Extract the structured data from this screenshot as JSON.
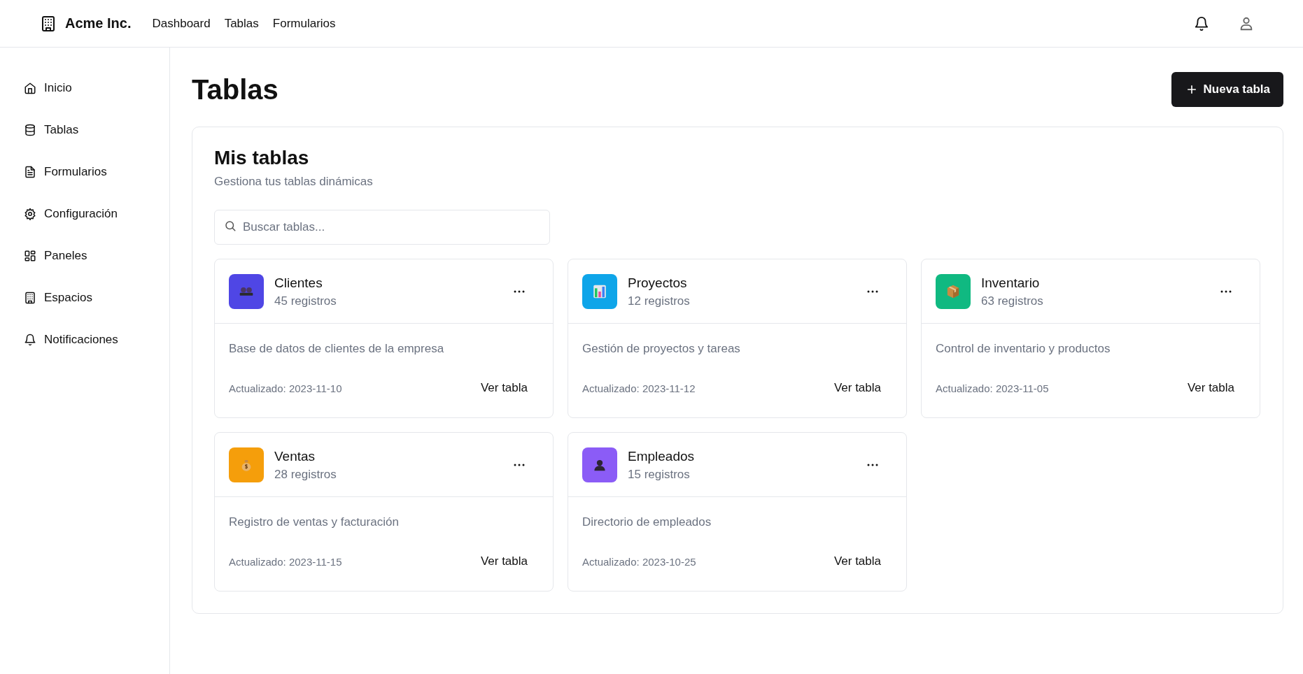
{
  "header": {
    "brand": "Acme Inc.",
    "nav": [
      "Dashboard",
      "Tablas",
      "Formularios"
    ]
  },
  "sidebar": {
    "items": [
      {
        "label": "Inicio"
      },
      {
        "label": "Tablas"
      },
      {
        "label": "Formularios"
      },
      {
        "label": "Configuración"
      },
      {
        "label": "Paneles"
      },
      {
        "label": "Espacios"
      },
      {
        "label": "Notificaciones"
      }
    ]
  },
  "page": {
    "title": "Tablas",
    "new_button": "Nueva tabla"
  },
  "panel": {
    "title": "Mis tablas",
    "subtitle": "Gestiona tus tablas dinámicas",
    "search": {
      "placeholder": "Buscar tablas..."
    }
  },
  "tables": [
    {
      "name": "Clientes",
      "count": "45 registros",
      "kind": "people",
      "color": "#4f46e5",
      "description": "Base de datos de clientes de la empresa",
      "updated": "Actualizado: 2023-11-10",
      "action": "Ver tabla"
    },
    {
      "name": "Proyectos",
      "count": "12 registros",
      "kind": "chart",
      "color": "#0ea5e9",
      "description": "Gestión de proyectos y tareas",
      "updated": "Actualizado: 2023-11-12",
      "action": "Ver tabla"
    },
    {
      "name": "Inventario",
      "count": "63 registros",
      "kind": "box",
      "color": "#10b981",
      "description": "Control de inventario y productos",
      "updated": "Actualizado: 2023-11-05",
      "action": "Ver tabla"
    },
    {
      "name": "Ventas",
      "count": "28 registros",
      "kind": "moneybag",
      "color": "#f59e0b",
      "description": "Registro de ventas y facturación",
      "updated": "Actualizado: 2023-11-15",
      "action": "Ver tabla"
    },
    {
      "name": "Empleados",
      "count": "15 registros",
      "kind": "person",
      "color": "#8b5cf6",
      "description": "Directorio de empleados",
      "updated": "Actualizado: 2023-10-25",
      "action": "Ver tabla"
    }
  ]
}
